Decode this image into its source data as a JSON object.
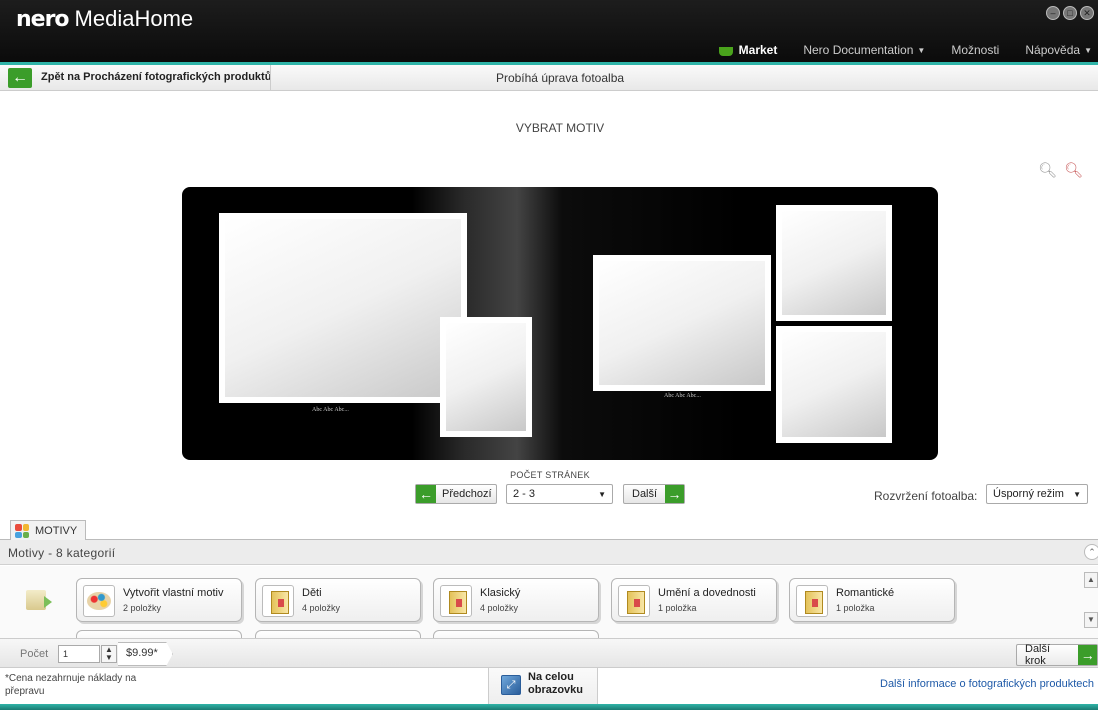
{
  "app": {
    "brand": "nero",
    "product": "MediaHome"
  },
  "top_menu": {
    "market": "Market",
    "documentation": "Nero Documentation",
    "options": "Možnosti",
    "help": "Nápověda"
  },
  "nav": {
    "back_label": "Zpět na Procházení fotografických produktů",
    "title": "Probíhá úprava fotoalba"
  },
  "main": {
    "heading": "VYBRAT MOTIV",
    "album_caption_left": "Abc Abc Abc...",
    "album_caption_right": "Abc Abc Abc...",
    "page_count_label": "POČET STRÁNEK",
    "prev_label": "Předchozí",
    "next_label": "Další",
    "page_select": "2 - 3",
    "layout_label": "Rozvržení fotoalba:",
    "layout_select": "Úsporný režim"
  },
  "themes": {
    "tab_label": "MOTIVY",
    "category_summary": "Motivy - 8 kategorií",
    "cards": [
      {
        "title": "Vytvořit vlastní motiv",
        "count": "2 položky",
        "icon": "palette-icon"
      },
      {
        "title": "Děti",
        "count": "4 položky",
        "icon": "book-icon"
      },
      {
        "title": "Klasický",
        "count": "4 položky",
        "icon": "book-icon"
      },
      {
        "title": "Umění a dovednosti",
        "count": "1 položka",
        "icon": "book-icon"
      },
      {
        "title": "Romantické",
        "count": "1 položka",
        "icon": "book-icon"
      }
    ]
  },
  "order": {
    "quantity_label": "Počet",
    "quantity_value": "1",
    "price": "$9.99*",
    "next_step": "Další krok"
  },
  "footer": {
    "note": "*Cena nezahrnuje náklady na přepravu",
    "fullscreen_line1": "Na celou",
    "fullscreen_line2": "obrazovku",
    "info_link": "Další informace o fotografických produktech"
  },
  "colors": {
    "accent": "#2fb4a8",
    "green": "#3b9d2a",
    "link": "#1f5aa8"
  }
}
